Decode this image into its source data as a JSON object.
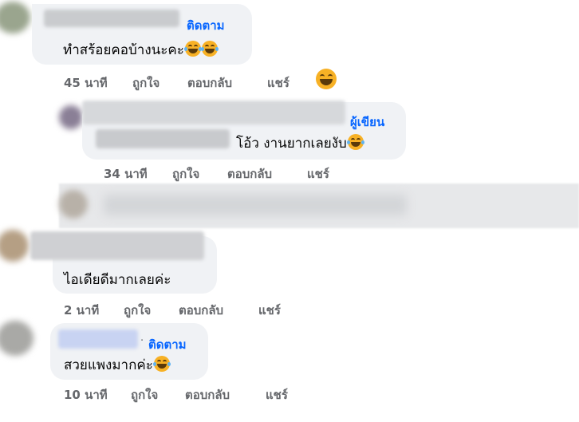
{
  "comments": [
    {
      "follow_label": "ติดตาม",
      "text": "ทำสร้อยคอบ้างนะคะ",
      "emoji": "laughing-tears-emoji x2",
      "time": "45 นาที",
      "like": "ถูกใจ",
      "reply": "ตอบกลับ",
      "share": "แชร์",
      "reaction": "grinning-emoji"
    },
    {
      "author_badge": "ผู้เขียน",
      "text": "โอ้ว งานยากเลยงับ",
      "emoji": "laughing-tears-emoji",
      "time": "34 นาที",
      "like": "ถูกใจ",
      "reply": "ตอบกลับ",
      "share": "แชร์"
    },
    {
      "text": "ไอเดียดีมากเลยค่ะ",
      "time": "2 นาที",
      "like": "ถูกใจ",
      "reply": "ตอบกลับ",
      "share": "แชร์"
    },
    {
      "separator": "·",
      "follow_label": "ติดตาม",
      "text": "สวยแพงมากค่ะ",
      "emoji": "laughing-tears-emoji",
      "time": "10 นาที",
      "like": "ถูกใจ",
      "reply": "ตอบกลับ",
      "share": "แชร์"
    }
  ],
  "colors": {
    "bubble": "#f0f2f5",
    "link_blue": "#0866ff",
    "meta_gray": "#65676b",
    "text": "#050505"
  }
}
